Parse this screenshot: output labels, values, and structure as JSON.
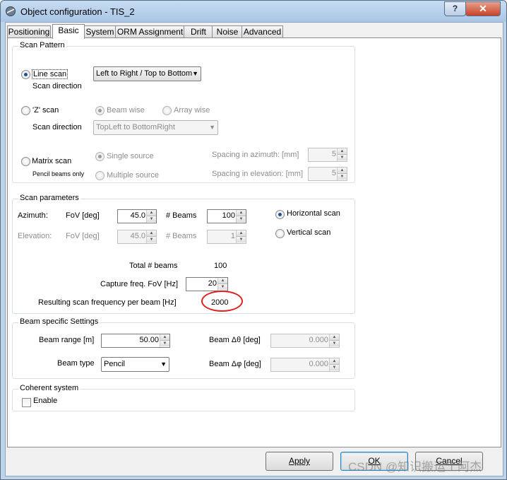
{
  "window": {
    "title": "Object configuration - TIS_2",
    "help_glyph": "?",
    "close_glyph": "✕"
  },
  "tabs": [
    {
      "label": "Positioning"
    },
    {
      "label": "Basic",
      "active": true
    },
    {
      "label": "System"
    },
    {
      "label": "ORM Assignment"
    },
    {
      "label": "Drift"
    },
    {
      "label": "Noise"
    },
    {
      "label": "Advanced"
    }
  ],
  "scan_pattern": {
    "label": "Scan Pattern",
    "line_scan": {
      "label": "Line scan",
      "checked": true,
      "direction_label": "Scan direction",
      "direction_value": "Left to Right / Top to Bottom"
    },
    "z_scan": {
      "label": "'Z' scan",
      "beam_wise": "Beam wise",
      "array_wise": "Array wise",
      "direction_label": "Scan direction",
      "direction_value": "TopLeft to BottomRight"
    },
    "matrix_scan": {
      "label": "Matrix scan",
      "note": "Pencil beams only",
      "single_source": "Single source",
      "multiple_source": "Multiple source",
      "spacing_azimuth_label": "Spacing in azimuth:  [mm]",
      "spacing_azimuth_value": "5",
      "spacing_elevation_label": "Spacing in elevation: [mm]",
      "spacing_elevation_value": "5"
    }
  },
  "scan_parameters": {
    "label": "Scan parameters",
    "azimuth": {
      "label": "Azimuth:",
      "fov_label": "FoV [deg]",
      "fov_value": "45.0",
      "beams_label": "# Beams",
      "beams_value": "100"
    },
    "elevation": {
      "label": "Elevation:",
      "fov_label": "FoV [deg]",
      "fov_value": "45.0",
      "beams_label": "# Beams",
      "beams_value": "1"
    },
    "horizontal_scan": "Horizontal scan",
    "vertical_scan": "Vertical scan",
    "total_beams_label": "Total # beams",
    "total_beams_value": "100",
    "capture_freq_label": "Capture freq. FoV [Hz]",
    "capture_freq_value": "20",
    "resulting_label": "Resulting scan frequency per beam [Hz]",
    "resulting_value": "2000"
  },
  "beam_settings": {
    "label": "Beam specific Settings",
    "range_label": "Beam range [m]",
    "range_value": "50.00",
    "type_label": "Beam type",
    "type_value": "Pencil",
    "dtheta_label": "Beam  Δθ [deg]",
    "dtheta_value": "0.000",
    "dphi_label": "Beam  Δφ [deg]",
    "dphi_value": "0.000"
  },
  "coherent": {
    "label": "Coherent system",
    "enable_label": "Enable",
    "checked": false
  },
  "buttons": {
    "apply": "Apply",
    "ok": "OK",
    "cancel": "Cancel"
  },
  "watermark": "CSDN @知识搬运工阿杰",
  "colors": {
    "annotation_circle": "#e02020",
    "radio_selected": "#1f4f99"
  }
}
